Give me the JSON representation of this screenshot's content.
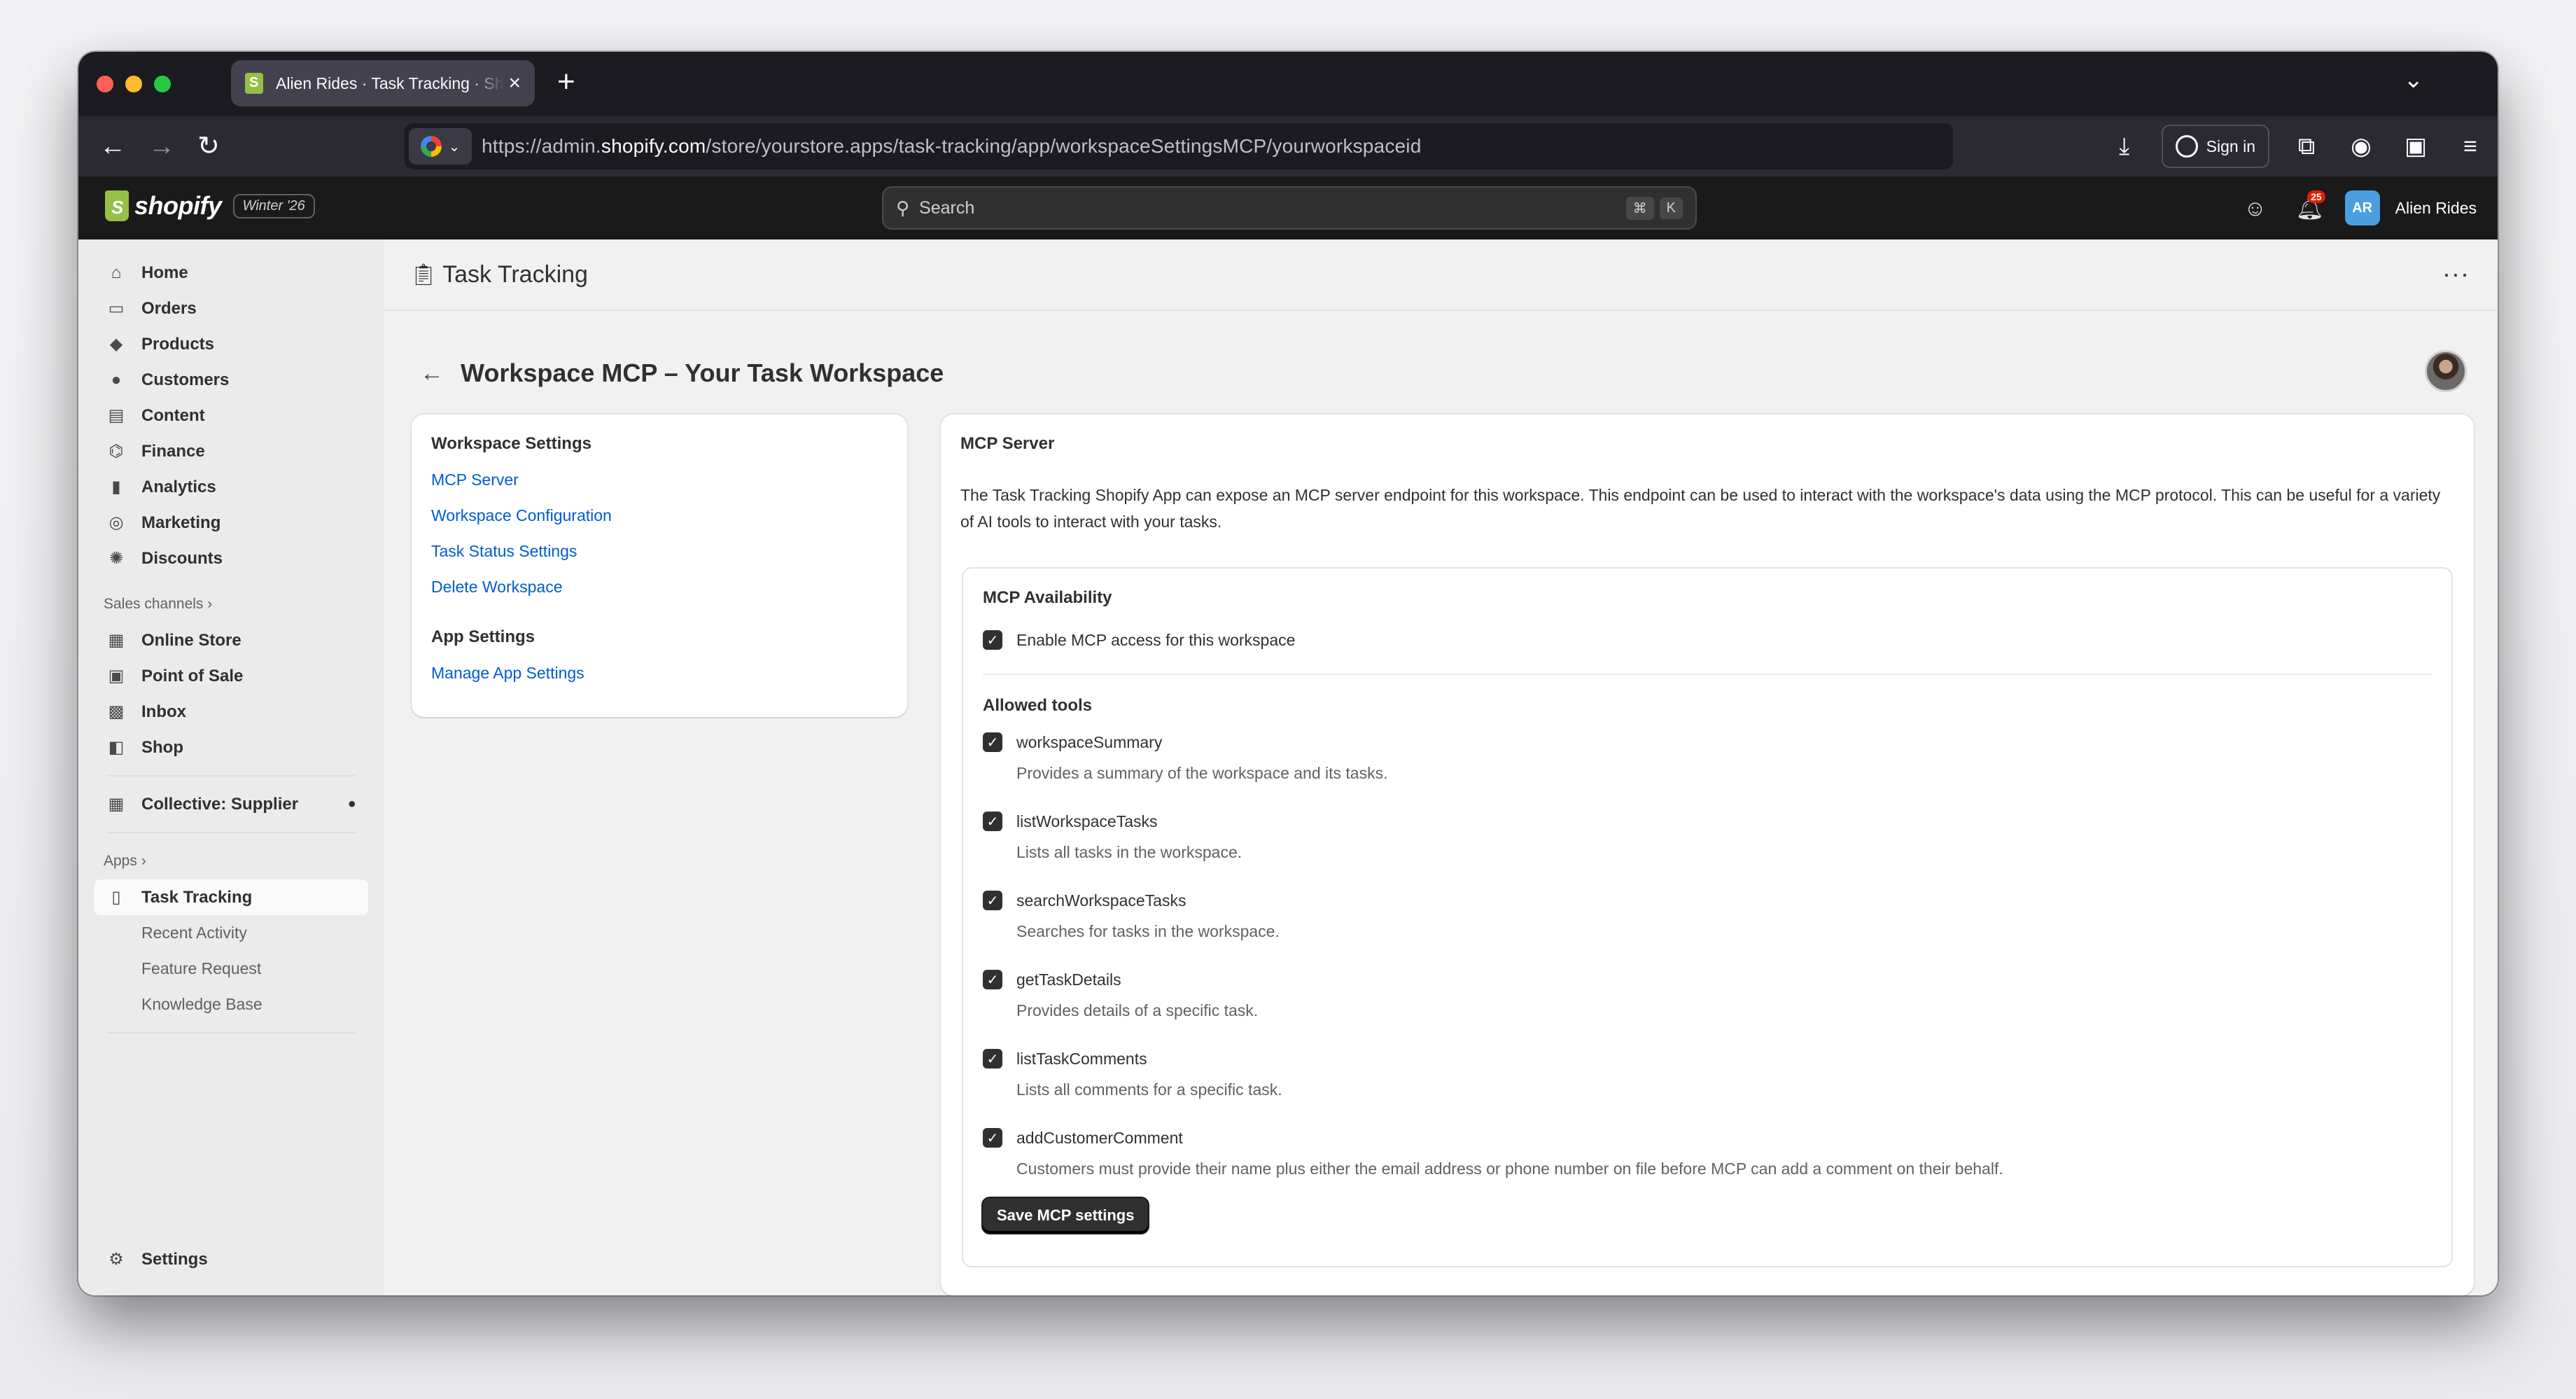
{
  "browser": {
    "tab_title": "Alien Rides · Task Tracking · Shopify",
    "url_prefix": "https://admin.",
    "url_domain": "shopify.com",
    "url_path": "/store/yourstore.apps/task-tracking/app/workspaceSettingsMCP/yourworkspaceid",
    "sign_in_label": "Sign in"
  },
  "shopify": {
    "logo_word": "shopify",
    "edition": "Winter '26",
    "search_placeholder": "Search",
    "shortcut_cmd": "⌘",
    "shortcut_key": "K",
    "notification_count": "25",
    "store_initials": "AR",
    "store_name": "Alien Rides"
  },
  "sidebar": {
    "items": [
      {
        "label": "Home",
        "icon": "home-icon"
      },
      {
        "label": "Orders",
        "icon": "orders-icon"
      },
      {
        "label": "Products",
        "icon": "tag-icon"
      },
      {
        "label": "Customers",
        "icon": "person-icon"
      },
      {
        "label": "Content",
        "icon": "content-icon"
      },
      {
        "label": "Finance",
        "icon": "bank-icon"
      },
      {
        "label": "Analytics",
        "icon": "bar-chart-icon"
      },
      {
        "label": "Marketing",
        "icon": "target-icon"
      },
      {
        "label": "Discounts",
        "icon": "discount-icon"
      }
    ],
    "sales_channels_label": "Sales channels",
    "channels": [
      {
        "label": "Online Store"
      },
      {
        "label": "Point of Sale"
      },
      {
        "label": "Inbox"
      },
      {
        "label": "Shop"
      }
    ],
    "collective_label": "Collective: Supplier",
    "apps_label": "Apps",
    "active_app": "Task Tracking",
    "app_subitems": [
      "Recent Activity",
      "Feature Request",
      "Knowledge Base"
    ],
    "settings_label": "Settings"
  },
  "app": {
    "title": "Task Tracking",
    "page_title": "Workspace MCP – Your Task Workspace"
  },
  "nav_card": {
    "workspace_heading": "Workspace Settings",
    "workspace_links": [
      "MCP Server",
      "Workspace Configuration",
      "Task Status Settings",
      "Delete Workspace"
    ],
    "app_heading": "App Settings",
    "app_links": [
      "Manage App Settings"
    ]
  },
  "mcp": {
    "heading": "MCP Server",
    "description": "The Task Tracking Shopify App can expose an MCP server endpoint for this workspace. This endpoint can be used to interact with the workspace's data using the MCP protocol. This can be useful for a variety of AI tools to interact with your tasks.",
    "availability_heading": "MCP Availability",
    "enable_label": "Enable MCP access for this workspace",
    "enable_checked": true,
    "allowed_tools_heading": "Allowed tools",
    "tools": [
      {
        "name": "workspaceSummary",
        "desc": "Provides a summary of the workspace and its tasks.",
        "checked": true
      },
      {
        "name": "listWorkspaceTasks",
        "desc": "Lists all tasks in the workspace.",
        "checked": true
      },
      {
        "name": "searchWorkspaceTasks",
        "desc": "Searches for tasks in the workspace.",
        "checked": true
      },
      {
        "name": "getTaskDetails",
        "desc": "Provides details of a specific task.",
        "checked": true
      },
      {
        "name": "listTaskComments",
        "desc": "Lists all comments for a specific task.",
        "checked": true
      },
      {
        "name": "addCustomerComment",
        "desc": "Customers must provide their name plus either the email address or phone number on file before MCP can add a comment on their behalf.",
        "checked": true
      }
    ],
    "save_label": "Save MCP settings"
  }
}
